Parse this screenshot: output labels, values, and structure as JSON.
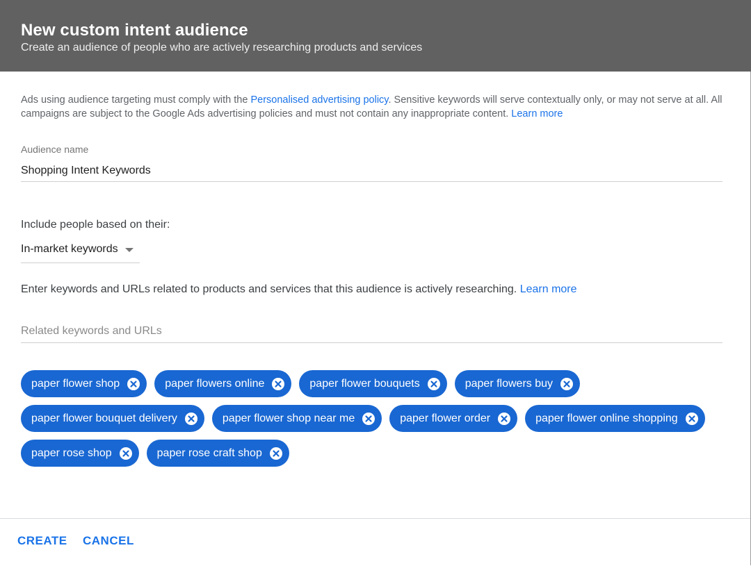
{
  "dialog": {
    "title": "New custom intent audience",
    "subtitle": "Create an audience of people who are actively researching products and services"
  },
  "policy": {
    "text_before": "Ads using audience targeting must comply with the ",
    "policy_link": "Personalised advertising policy",
    "text_after": ". Sensitive keywords will serve contextually only, or may not serve at all. All campaigns are subject to the Google Ads advertising policies and must not contain any inappropriate content. ",
    "learn_more": "Learn more"
  },
  "audience_name": {
    "label": "Audience name",
    "value": "Shopping Intent Keywords"
  },
  "include": {
    "label": "Include people based on their:",
    "selected": "In-market keywords"
  },
  "keywords": {
    "description": "Enter keywords and URLs related to products and services that this audience is actively researching. ",
    "learn_more": "Learn more",
    "placeholder": "Related keywords and URLs",
    "chips": [
      "paper flower shop",
      "paper flowers online",
      "paper flower bouquets",
      "paper flowers buy",
      "paper flower bouquet delivery",
      "paper flower shop near me",
      "paper flower order",
      "paper flower online shopping",
      "paper rose shop",
      "paper rose craft shop"
    ]
  },
  "footer": {
    "create_label": "CREATE",
    "cancel_label": "CANCEL"
  },
  "colors": {
    "header_bg": "#616161",
    "chip_bg": "#1967d2",
    "link": "#1a73e8"
  },
  "icons": {
    "chip_remove": "close-circle-icon",
    "dropdown": "caret-down-icon"
  }
}
